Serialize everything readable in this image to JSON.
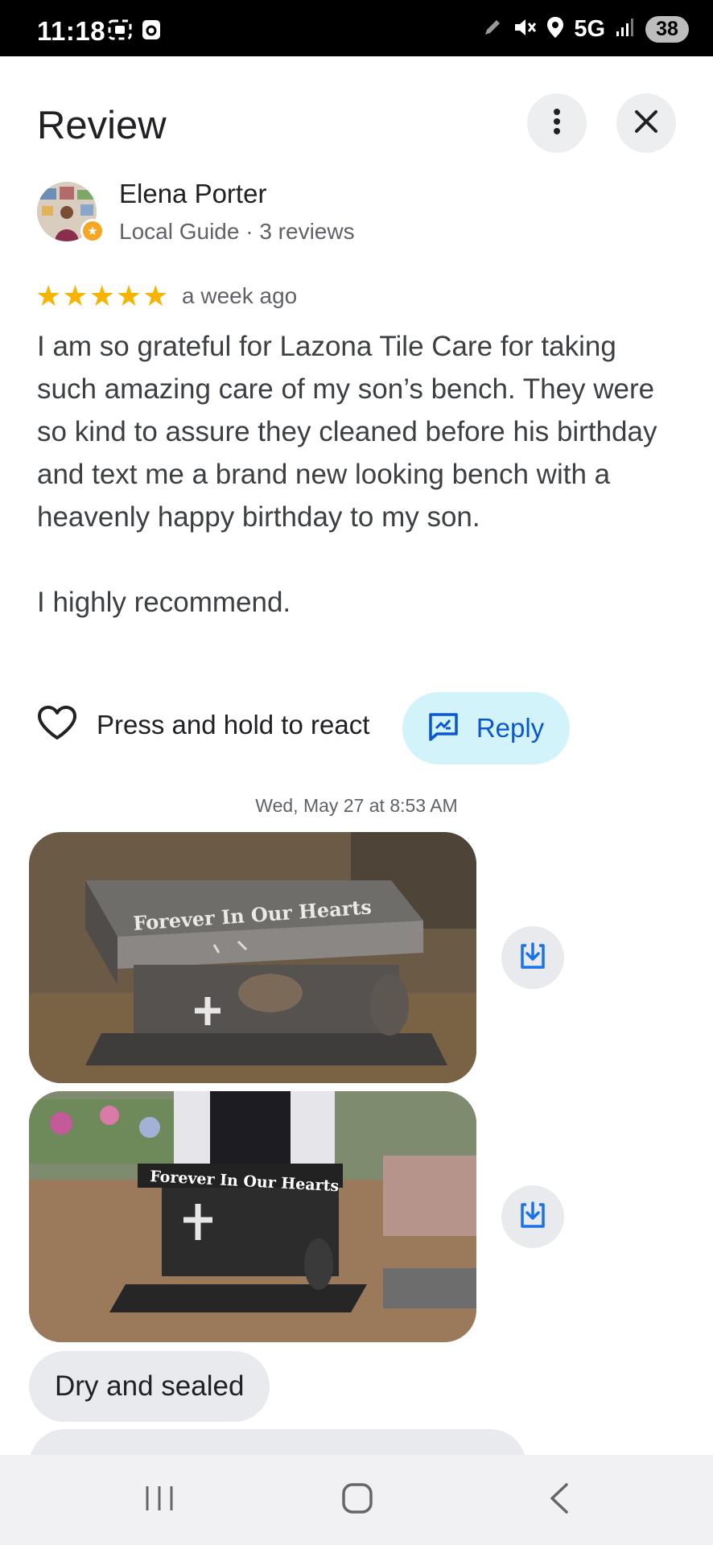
{
  "status_bar": {
    "time": "11:18",
    "network": "5G",
    "battery": "38",
    "icons": [
      "screenshot-icon",
      "app-icon",
      "pen-icon",
      "mute-icon",
      "location-icon",
      "signal-icon"
    ]
  },
  "header": {
    "title": "Review",
    "more_icon": "more-vert-icon",
    "close_icon": "close-icon"
  },
  "reviewer": {
    "name": "Elena Porter",
    "meta": "Local Guide · 3 reviews"
  },
  "review": {
    "rating": 5,
    "max_rating": 5,
    "time": "a week ago",
    "paragraphs": [
      "I am so grateful for Lazona Tile Care for taking such amazing care of my son’s bench.  They were so kind to assure they cleaned before his birthday and text me a brand new looking bench with a heavenly happy birthday to my son.",
      "I highly recommend."
    ]
  },
  "actions": {
    "react_label": "Press and hold to react",
    "reply_label": "Reply"
  },
  "chat": {
    "date": "Wed, May 27 at 8:53 AM",
    "photo_caption_1": "Forever In Our Hearts",
    "photo_caption_2": "Forever In Our Hearts",
    "bubble_text": "Dry and sealed"
  },
  "colors": {
    "star": "#f6b400",
    "reply_bg": "#d3f3fb",
    "accent": "#0b57d0"
  }
}
